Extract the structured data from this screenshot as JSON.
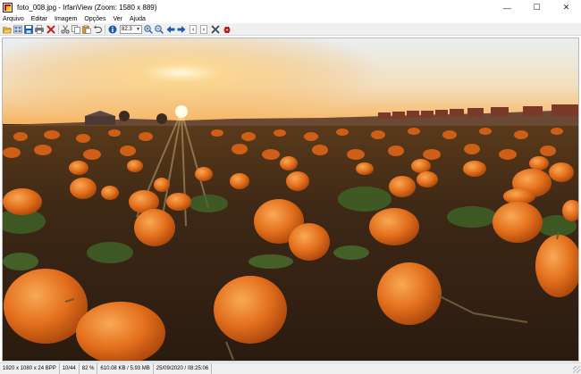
{
  "window": {
    "title": "foto_008.jpg - IrfanView (Zoom: 1580 x 889)",
    "icon": "irfanview-app-icon",
    "controls": {
      "minimize": "—",
      "maximize": "☐",
      "close": "✕"
    }
  },
  "menu": {
    "items": [
      "Arquivo",
      "Editar",
      "Imagem",
      "Opções",
      "Ver",
      "Ajuda"
    ]
  },
  "toolbar": {
    "zoom_value": "82.3",
    "buttons": [
      "open-folder-icon",
      "thumbnails-icon",
      "save-icon",
      "print-icon",
      "delete-icon",
      "cut-icon",
      "copy-icon",
      "paste-icon",
      "undo-icon",
      "info-icon",
      "zoom-in-icon",
      "zoom-out-icon",
      "previous-icon",
      "next-icon",
      "previous-page-icon",
      "next-page-icon",
      "settings-icon",
      "exit-icon"
    ]
  },
  "image": {
    "description_label": "photo-viewport",
    "colors": {
      "sky_top": "#e9eff3",
      "horizon": "#f7c07a",
      "sun": "#fff3c8",
      "soil": "#3a2515",
      "pumpkin": "#e4701c",
      "pumpkin_light": "#f59a45"
    }
  },
  "status": {
    "dimensions": "1920 x 1080 x 24 BPP",
    "position": "10/44",
    "zoom": "82 %",
    "size": "610.08 KB / 5.93 MB",
    "datetime": "25/09/2020 / 08:25:06"
  },
  "accent_colors": {
    "toolbar_bg": "#f0f0f0",
    "icon_blue": "#1e5aa8",
    "icon_red": "#cc1f1f",
    "icon_green": "#2f8a2f"
  }
}
